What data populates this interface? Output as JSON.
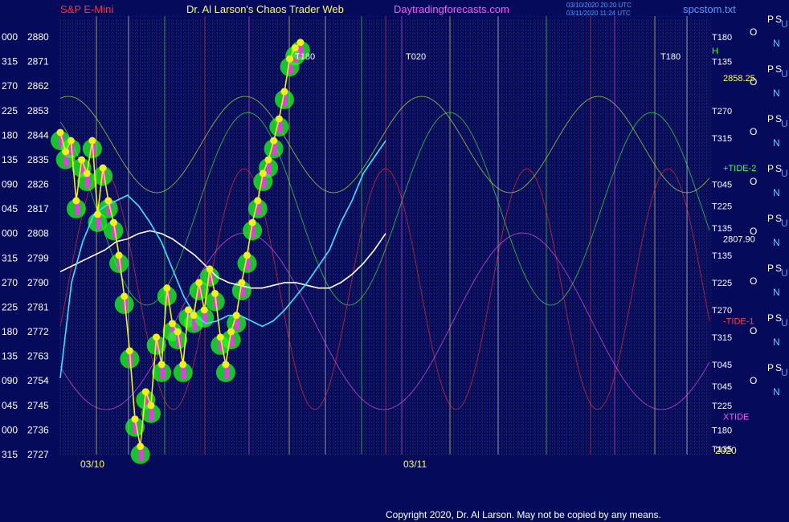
{
  "header": {
    "instrument": "S&P E-Mini",
    "site": "Dr. Al Larson's Chaos Trader Web",
    "link": "Daytradingforecasts.com",
    "file": "spcstom.txt",
    "timestamp1": "03/10/2020 20:20 UTC",
    "timestamp2": "03/11/2020 11:24 UTC",
    "copyright": "Copyright 2020, Dr. Al Larson. May not be copied by any means.",
    "colors": {
      "instrument": "#ff3030",
      "site": "#ffff66",
      "link": "#ff55ff",
      "file": "#4aa0ff"
    }
  },
  "chart_data": {
    "type": "line",
    "xlabels": [
      "03/10",
      "03/11"
    ],
    "year_label": "2020",
    "ylim": [
      2727,
      2880
    ],
    "y_ticks": [
      {
        "left": "000",
        "right": "2880"
      },
      {
        "left": "315",
        "right": "2871"
      },
      {
        "left": "270",
        "right": "2862"
      },
      {
        "left": "225",
        "right": "2853"
      },
      {
        "left": "180",
        "right": "2844"
      },
      {
        "left": "135",
        "right": "2835"
      },
      {
        "left": "090",
        "right": "2826"
      },
      {
        "left": "045",
        "right": "2817"
      },
      {
        "left": "000",
        "right": "2808"
      },
      {
        "left": "315",
        "right": "2799"
      },
      {
        "left": "270",
        "right": "2790"
      },
      {
        "left": "225",
        "right": "2781"
      },
      {
        "left": "180",
        "right": "2772"
      },
      {
        "left": "135",
        "right": "2763"
      },
      {
        "left": "090",
        "right": "2754"
      },
      {
        "left": "045",
        "right": "2745"
      },
      {
        "left": "000",
        "right": "2736"
      },
      {
        "left": "315",
        "right": "2727"
      }
    ],
    "price_series": {
      "name": "price",
      "x": [
        0,
        0.01,
        0.02,
        0.03,
        0.04,
        0.05,
        0.06,
        0.07,
        0.08,
        0.09,
        0.1,
        0.11,
        0.12,
        0.13,
        0.14,
        0.15,
        0.16,
        0.17,
        0.18,
        0.19,
        0.2,
        0.21,
        0.22,
        0.23,
        0.24,
        0.25,
        0.26,
        0.27,
        0.28,
        0.29,
        0.3,
        0.31,
        0.32,
        0.33,
        0.34,
        0.35,
        0.36,
        0.37,
        0.38,
        0.39,
        0.4,
        0.41,
        0.42,
        0.43,
        0.44,
        0.45,
        0.46,
        0.47,
        0.48,
        0.49,
        0.5
      ],
      "y": [
        2845,
        2838,
        2842,
        2820,
        2835,
        2830,
        2842,
        2815,
        2832,
        2820,
        2812,
        2800,
        2785,
        2765,
        2740,
        2730,
        2750,
        2745,
        2770,
        2760,
        2788,
        2775,
        2772,
        2760,
        2780,
        2778,
        2790,
        2780,
        2795,
        2786,
        2770,
        2760,
        2772,
        2778,
        2790,
        2800,
        2812,
        2820,
        2830,
        2835,
        2842,
        2850,
        2860,
        2872,
        2876,
        2878,
        null,
        null,
        null,
        null,
        null
      ],
      "color": "#f0f020"
    },
    "ma_series": [
      {
        "color": "#ffffff",
        "y": [
          2794,
          2796,
          2798,
          2800,
          2802,
          2805,
          2806,
          2808,
          2809,
          2808,
          2806,
          2803,
          2800,
          2796,
          2792,
          2790,
          2789,
          2788,
          2788,
          2789,
          2790,
          2790,
          2789,
          2788,
          2788,
          2790,
          2793,
          2797,
          2802,
          2808
        ]
      },
      {
        "color": "#40e0ff",
        "y": [
          2755,
          2790,
          2805,
          2815,
          2818,
          2820,
          2822,
          2818,
          2812,
          2805,
          2795,
          2785,
          2778,
          2775,
          2776,
          2778,
          2778,
          2776,
          2774,
          2776,
          2780,
          2785,
          2790,
          2796,
          2802,
          2812,
          2820,
          2830,
          2836,
          2842
        ]
      }
    ],
    "cycle_labels": [
      "T180",
      "T020",
      "T180"
    ],
    "right_labels": [
      {
        "label": "T180",
        "y": 2880,
        "color": "#ffffff"
      },
      {
        "label": "H",
        "y": 2875,
        "color": "#40ff40"
      },
      {
        "label": "T135",
        "y": 2871,
        "color": "#ffffff"
      },
      {
        "label": "2858.25",
        "y": 2865,
        "color": "#ffff66"
      },
      {
        "label": "T270",
        "y": 2853,
        "color": "#ffffff"
      },
      {
        "label": "T315",
        "y": 2843,
        "color": "#ffffff"
      },
      {
        "label": "+TIDE-2",
        "y": 2832,
        "color": "#40ff40"
      },
      {
        "label": "T045",
        "y": 2826,
        "color": "#ffffff"
      },
      {
        "label": "T225",
        "y": 2818,
        "color": "#ffffff"
      },
      {
        "label": "T135",
        "y": 2810,
        "color": "#ffffff"
      },
      {
        "label": "2807.90",
        "y": 2806,
        "color": "#ffffff"
      },
      {
        "label": "T135",
        "y": 2800,
        "color": "#ffffff"
      },
      {
        "label": "T225",
        "y": 2790,
        "color": "#ffffff"
      },
      {
        "label": "T270",
        "y": 2780,
        "color": "#ffffff"
      },
      {
        "label": "-TIDE-1",
        "y": 2776,
        "color": "#ff4040"
      },
      {
        "label": "T315",
        "y": 2770,
        "color": "#ffffff"
      },
      {
        "label": "T045",
        "y": 2760,
        "color": "#ffffff"
      },
      {
        "label": "T045",
        "y": 2752,
        "color": "#ffffff"
      },
      {
        "label": "T225",
        "y": 2745,
        "color": "#ffffff"
      },
      {
        "label": "XTIDE",
        "y": 2741,
        "color": "#ff55ff"
      },
      {
        "label": "T180",
        "y": 2736,
        "color": "#ffffff"
      },
      {
        "label": "T135",
        "y": 2729,
        "color": "#ffffff"
      }
    ],
    "ps_letters": [
      "P",
      "S",
      "O",
      "U",
      "N"
    ]
  }
}
